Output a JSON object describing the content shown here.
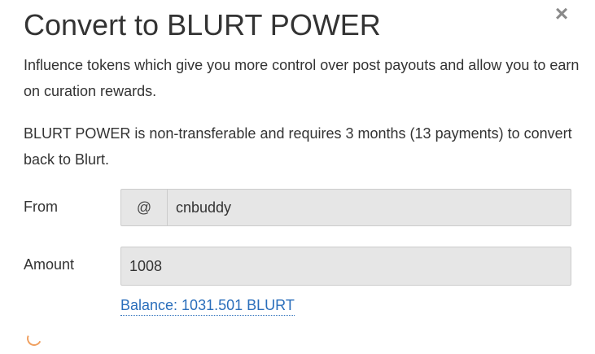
{
  "modal": {
    "title": "Convert to BLURT POWER",
    "close_glyph": "×",
    "description_1": "Influence tokens which give you more control over post payouts and allow you to earn on curation rewards.",
    "description_2": "BLURT POWER is non-transferable and requires 3 months (13 payments) to convert back to Blurt."
  },
  "form": {
    "from_label": "From",
    "from_prefix": "@",
    "from_value": "cnbuddy",
    "amount_label": "Amount",
    "amount_value": "1008",
    "balance_text": "Balance: 1031.501 BLURT"
  },
  "icons": {
    "close": "close-icon",
    "loading": "loading-spinner-icon"
  },
  "colors": {
    "link": "#2a6ebb",
    "input_bg": "#e6e6e6",
    "spinner": "#f0a060"
  }
}
